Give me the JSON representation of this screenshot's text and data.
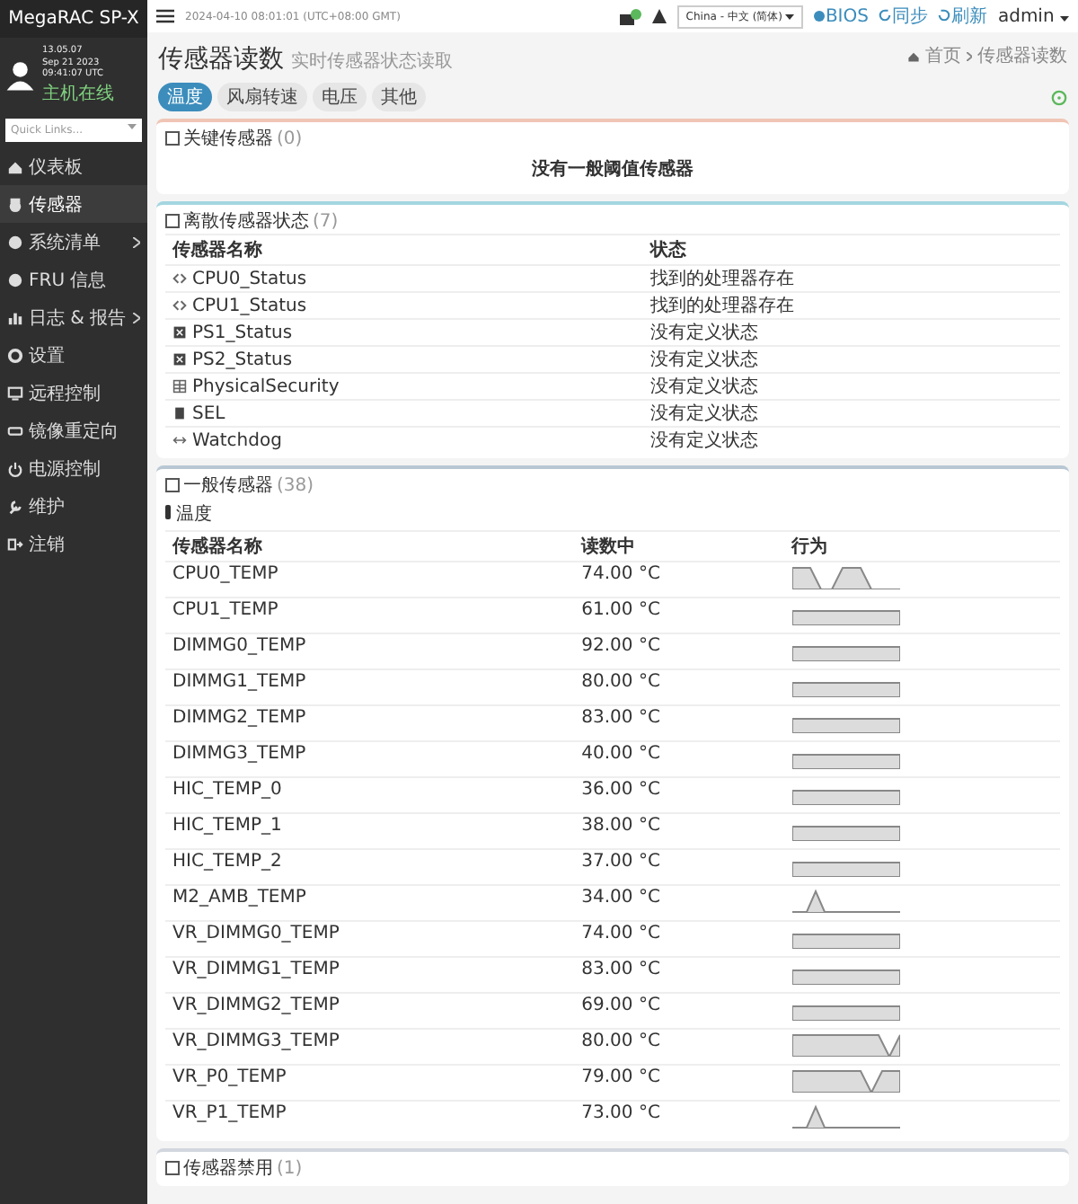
{
  "sidebar": {
    "brand": "MegaRAC SP-X",
    "user": {
      "name": "13.05.07",
      "time": "Sep 21 2023 09:41:07 UTC",
      "status": "主机在线"
    },
    "quick_links": {
      "placeholder": "Quick Links..."
    },
    "items": [
      {
        "label": "仪表板",
        "selected": false,
        "submenu": false
      },
      {
        "label": "传感器",
        "selected": true,
        "submenu": false
      },
      {
        "label": "系统清单",
        "selected": false,
        "submenu": true
      },
      {
        "label": "FRU 信息",
        "selected": false,
        "submenu": false
      },
      {
        "label": "日志 & 报告",
        "selected": false,
        "submenu": true
      },
      {
        "label": "设置",
        "selected": false,
        "submenu": false
      },
      {
        "label": "远程控制",
        "selected": false,
        "submenu": false
      },
      {
        "label": "镜像重定向",
        "selected": false,
        "submenu": false
      },
      {
        "label": "电源控制",
        "selected": false,
        "submenu": false
      },
      {
        "label": "维护",
        "selected": false,
        "submenu": false
      },
      {
        "label": "注销",
        "selected": false,
        "submenu": false
      }
    ]
  },
  "top_bar": {
    "datetime": "2024-04-10 08:01:01 (UTC+08:00 GMT)",
    "language": "China - 中文 (简体)",
    "bios": "BIOS",
    "sync": "同步",
    "refresh": "刷新",
    "user": "admin"
  },
  "header": {
    "title": "传感器读数",
    "subtitle": "实时传感器状态读取",
    "breadcrumb": [
      "首页",
      "传感器读数"
    ]
  },
  "tabs": [
    {
      "label": "温度",
      "selected": true
    },
    {
      "label": "风扇转速",
      "selected": false
    },
    {
      "label": "电压",
      "selected": false
    },
    {
      "label": "其他",
      "selected": false
    }
  ],
  "critical": {
    "title": "关键传感器",
    "count": "(0)",
    "message": "没有一般阈值传感器"
  },
  "discrete": {
    "title": "离散传感器状态",
    "count": "(7)",
    "columns": [
      "传感器名称",
      "状态"
    ],
    "rows": [
      {
        "name": "CPU0_Status",
        "status": "找到的处理器存在"
      },
      {
        "name": "CPU1_Status",
        "status": "找到的处理器存在"
      },
      {
        "name": "PS1_Status",
        "status": "没有定义状态"
      },
      {
        "name": "PS2_Status",
        "status": "没有定义状态"
      },
      {
        "name": "PhysicalSecurity",
        "status": "没有定义状态"
      },
      {
        "name": "SEL",
        "status": "没有定义状态"
      },
      {
        "name": "Watchdog",
        "status": "没有定义状态"
      }
    ]
  },
  "normal": {
    "title": "一般传感器",
    "count": "(38)",
    "section": "温度",
    "columns": [
      "传感器名称",
      "读数中",
      "行为"
    ],
    "rows": [
      {
        "name": "CPU0_TEMP",
        "reading": "74.00 °C",
        "kind": "plateau"
      },
      {
        "name": "CPU1_TEMP",
        "reading": "61.00 °C",
        "kind": "flat"
      },
      {
        "name": "DIMMG0_TEMP",
        "reading": "92.00 °C",
        "kind": "flat"
      },
      {
        "name": "DIMMG1_TEMP",
        "reading": "80.00 °C",
        "kind": "flat"
      },
      {
        "name": "DIMMG2_TEMP",
        "reading": "83.00 °C",
        "kind": "flat"
      },
      {
        "name": "DIMMG3_TEMP",
        "reading": "40.00 °C",
        "kind": "flat"
      },
      {
        "name": "HIC_TEMP_0",
        "reading": "36.00 °C",
        "kind": "flat"
      },
      {
        "name": "HIC_TEMP_1",
        "reading": "38.00 °C",
        "kind": "flat"
      },
      {
        "name": "HIC_TEMP_2",
        "reading": "37.00 °C",
        "kind": "flat"
      },
      {
        "name": "M2_AMB_TEMP",
        "reading": "34.00 °C",
        "kind": "peak"
      },
      {
        "name": "VR_DIMMG0_TEMP",
        "reading": "74.00 °C",
        "kind": "flat"
      },
      {
        "name": "VR_DIMMG1_TEMP",
        "reading": "83.00 °C",
        "kind": "flat"
      },
      {
        "name": "VR_DIMMG2_TEMP",
        "reading": "69.00 °C",
        "kind": "flat"
      },
      {
        "name": "VR_DIMMG3_TEMP",
        "reading": "80.00 °C",
        "kind": "dip"
      },
      {
        "name": "VR_P0_TEMP",
        "reading": "79.00 °C",
        "kind": "notch"
      },
      {
        "name": "VR_P1_TEMP",
        "reading": "73.00 °C",
        "kind": "peak"
      }
    ]
  },
  "disabled": {
    "title": "传感器禁用",
    "count": "(1)"
  }
}
